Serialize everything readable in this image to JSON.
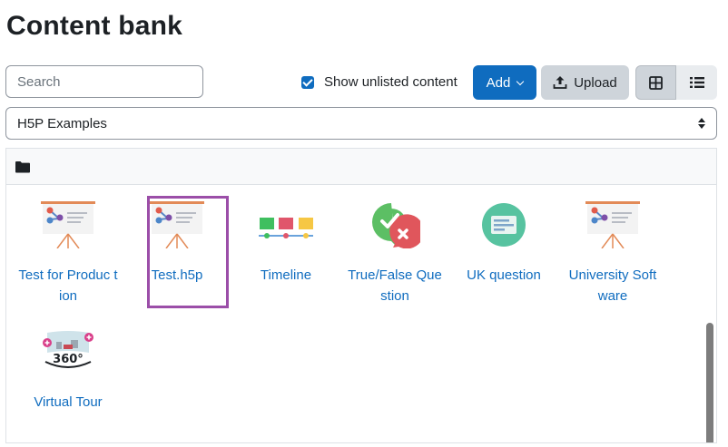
{
  "page": {
    "title": "Content bank"
  },
  "search": {
    "placeholder": "Search",
    "value": ""
  },
  "unlisted": {
    "label": "Show unlisted content",
    "checked": true
  },
  "toolbar": {
    "add_label": "Add",
    "upload_label": "Upload"
  },
  "view": {
    "icons_view": "grid-icon",
    "list_view": "list-icon",
    "active": "icons"
  },
  "context_select": {
    "selected": "H5P Examples"
  },
  "breadcrumb": {
    "icon": "folder-icon"
  },
  "files": [
    {
      "name": "Test for Production",
      "display": "Test for Produc tion",
      "icon": "presentation-icon",
      "selected": false
    },
    {
      "name": "Test.h5p",
      "display": "Test.h5p",
      "icon": "presentation-icon",
      "selected": true
    },
    {
      "name": "Timeline",
      "display": "Timeline",
      "icon": "timeline-icon",
      "selected": false
    },
    {
      "name": "True/False Question",
      "display": "True/False Que stion",
      "icon": "true-false-icon",
      "selected": false
    },
    {
      "name": "UK question",
      "display": "UK question",
      "icon": "form-icon",
      "selected": false
    },
    {
      "name": "University Software",
      "display": "University Soft ware",
      "icon": "presentation-icon",
      "selected": false
    },
    {
      "name": "Virtual Tour",
      "display": "Virtual Tour",
      "icon": "virtual-tour-360-icon",
      "selected": false
    }
  ],
  "colors": {
    "primary": "#0f6cbf",
    "selection": "#9b4ea8",
    "secondary": "#ced4da"
  }
}
